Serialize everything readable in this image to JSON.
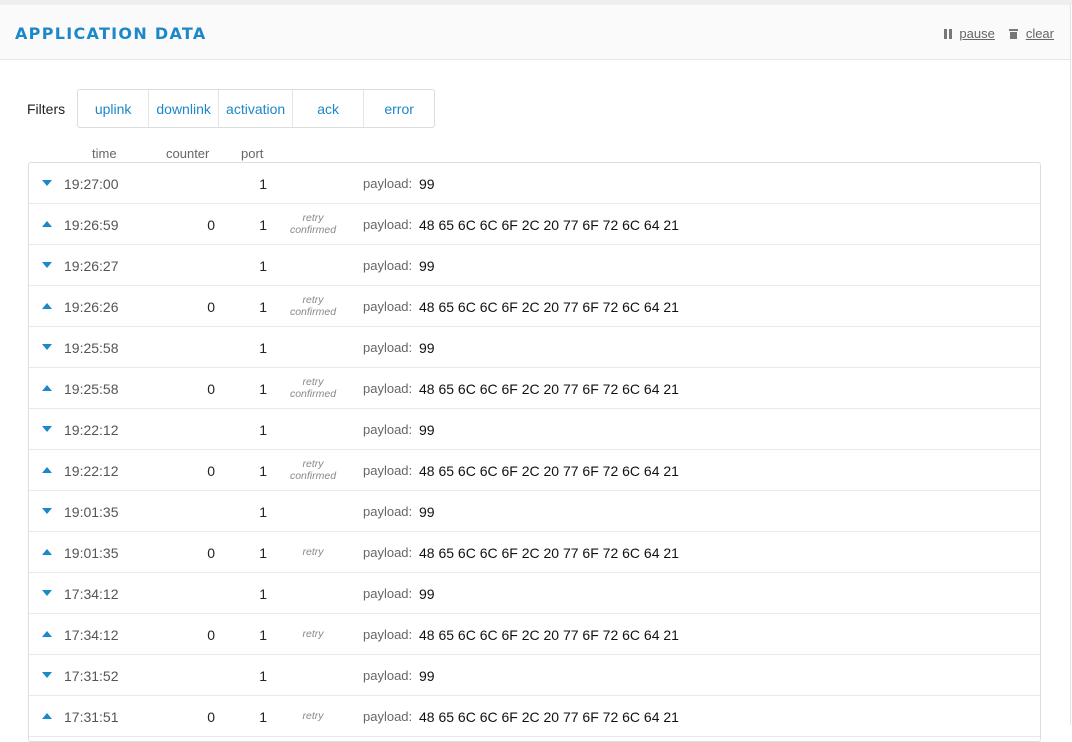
{
  "header": {
    "title": "APPLICATION DATA",
    "pause_label": "pause",
    "clear_label": "clear"
  },
  "filters": {
    "label": "Filters",
    "options": [
      "uplink",
      "downlink",
      "activation",
      "ack",
      "error"
    ]
  },
  "columns": {
    "time": "time",
    "counter": "counter",
    "port": "port"
  },
  "payload_label": "payload:",
  "colors": {
    "accent": "#1c87c9"
  },
  "icons": {
    "pause": "pause-icon",
    "clear": "trash-icon",
    "downlink": "arrow-down-icon",
    "uplink": "arrow-up-icon"
  },
  "rows": [
    {
      "dir": "down",
      "time": "19:27:00",
      "counter": "",
      "port": "1",
      "flags": [],
      "payload": "99"
    },
    {
      "dir": "up",
      "time": "19:26:59",
      "counter": "0",
      "port": "1",
      "flags": [
        "retry",
        "confirmed"
      ],
      "payload": "48 65 6C 6C 6F 2C 20 77 6F 72 6C 64 21"
    },
    {
      "dir": "down",
      "time": "19:26:27",
      "counter": "",
      "port": "1",
      "flags": [],
      "payload": "99"
    },
    {
      "dir": "up",
      "time": "19:26:26",
      "counter": "0",
      "port": "1",
      "flags": [
        "retry",
        "confirmed"
      ],
      "payload": "48 65 6C 6C 6F 2C 20 77 6F 72 6C 64 21"
    },
    {
      "dir": "down",
      "time": "19:25:58",
      "counter": "",
      "port": "1",
      "flags": [],
      "payload": "99"
    },
    {
      "dir": "up",
      "time": "19:25:58",
      "counter": "0",
      "port": "1",
      "flags": [
        "retry",
        "confirmed"
      ],
      "payload": "48 65 6C 6C 6F 2C 20 77 6F 72 6C 64 21"
    },
    {
      "dir": "down",
      "time": "19:22:12",
      "counter": "",
      "port": "1",
      "flags": [],
      "payload": "99"
    },
    {
      "dir": "up",
      "time": "19:22:12",
      "counter": "0",
      "port": "1",
      "flags": [
        "retry",
        "confirmed"
      ],
      "payload": "48 65 6C 6C 6F 2C 20 77 6F 72 6C 64 21"
    },
    {
      "dir": "down",
      "time": "19:01:35",
      "counter": "",
      "port": "1",
      "flags": [],
      "payload": "99"
    },
    {
      "dir": "up",
      "time": "19:01:35",
      "counter": "0",
      "port": "1",
      "flags": [
        "retry"
      ],
      "payload": "48 65 6C 6C 6F 2C 20 77 6F 72 6C 64 21"
    },
    {
      "dir": "down",
      "time": "17:34:12",
      "counter": "",
      "port": "1",
      "flags": [],
      "payload": "99"
    },
    {
      "dir": "up",
      "time": "17:34:12",
      "counter": "0",
      "port": "1",
      "flags": [
        "retry"
      ],
      "payload": "48 65 6C 6C 6F 2C 20 77 6F 72 6C 64 21"
    },
    {
      "dir": "down",
      "time": "17:31:52",
      "counter": "",
      "port": "1",
      "flags": [],
      "payload": "99"
    },
    {
      "dir": "up",
      "time": "17:31:51",
      "counter": "0",
      "port": "1",
      "flags": [
        "retry"
      ],
      "payload": "48 65 6C 6C 6F 2C 20 77 6F 72 6C 64 21"
    }
  ]
}
